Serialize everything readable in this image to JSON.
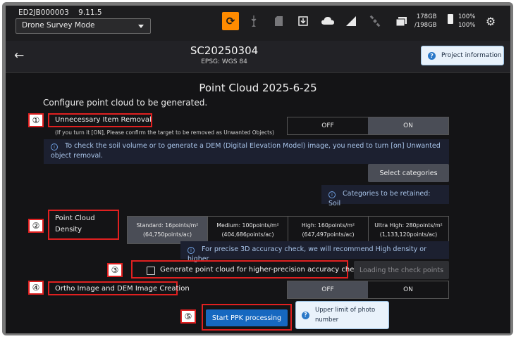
{
  "status_bar": {
    "device_id": "ED2JB000003",
    "version": "9.11.5",
    "mode": "Drone Survey Mode",
    "storage_used": "178GB",
    "storage_total": "/198GB",
    "battery_1": "100%",
    "battery_2": "100%"
  },
  "header": {
    "title": "SC20250304",
    "subtitle": "EPSG: WGS 84",
    "project_info_label": "Project information"
  },
  "main": {
    "title": "Point Cloud 2025-6-25",
    "subtitle": "Configure point cloud to be generated."
  },
  "markers": [
    "①",
    "②",
    "③",
    "④",
    "⑤"
  ],
  "unnecessary": {
    "label": "Unnecessary Item Removal",
    "note": "(If you turn it [ON], Please confirm the target to be removed as Unwanted Objects)",
    "toggle_off": "OFF",
    "toggle_on": "ON",
    "selected": "ON",
    "info": "To check the soil volume or to generate a DEM (Digital Elevation Model) image, you need to turn [on] Unwanted object removal.",
    "select_categories": "Select categories",
    "retained_info": "Categories to be retained: Soil"
  },
  "density": {
    "label_line1": "Point Cloud",
    "label_line2": "Density",
    "options": [
      {
        "line1": "Standard: 16points/m²",
        "line2": "(64,750points/ac)"
      },
      {
        "line1": "Medium: 100points/m²",
        "line2": "(404,686points/ac)"
      },
      {
        "line1": "High: 160points/m²",
        "line2": "(647,497points/ac)"
      },
      {
        "line1": "Ultra High: 280points/m²",
        "line2": "(1,133,120points/ac)"
      }
    ],
    "selected": "Standard",
    "info": "For precise 3D accuracy check, we will recommend High density or higher."
  },
  "accuracy": {
    "checkbox_label": "Generate point cloud for higher-precision accuracy check.",
    "checked": false,
    "load_button": "Loading the check points"
  },
  "ortho": {
    "label": "Ortho Image and DEM Image Creation",
    "toggle_off": "OFF",
    "toggle_on": "ON",
    "selected": "OFF"
  },
  "actions": {
    "start_ppk": "Start PPK processing",
    "upper_limit_line1": "Upper limit of photo",
    "upper_limit_line2": "number"
  },
  "icons": [
    "share-icon",
    "usb-icon",
    "sd-card-icon",
    "download-icon",
    "cloud-icon",
    "signal-icon",
    "satellite-icon",
    "storage-icon",
    "battery-icon",
    "gear-icon",
    "back-arrow-icon",
    "info-icon",
    "question-icon"
  ],
  "colors": {
    "accent": "#ff8b00",
    "primary": "#1668c0",
    "highlight": "#e02020"
  }
}
